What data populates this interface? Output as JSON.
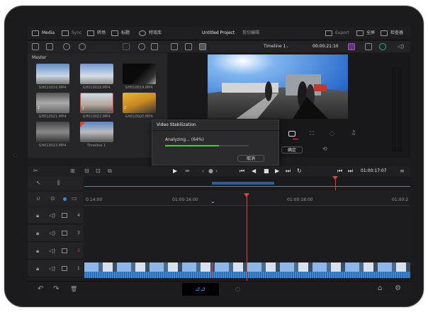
{
  "topbar": {
    "media": "Media",
    "sync": "Sync",
    "title_btn": "转场",
    "effects": "标题",
    "ext": "特效库",
    "project": "Untitled Project",
    "project_sub": "剪切编辑",
    "export": "Export",
    "fullscreen": "全屏",
    "inspector": "检查器"
  },
  "pool": {
    "heading": "Master",
    "clips": [
      "GH010016.MP4",
      "GH010018.MP4",
      "GH010019.MP4",
      "GH010021.MP4",
      "GH010022.MP4",
      "GH010020.MP4",
      "GH010023.MP4",
      "Timeline 1"
    ]
  },
  "viewer": {
    "timeline_name": "Timeline 1",
    "timecode": "00:00:21:10",
    "confirm": "确定"
  },
  "dialog": {
    "title": "Video Stabilization",
    "status": "Analyzing... (64%)",
    "progress": 0.64,
    "cancel": "取消"
  },
  "timeline": {
    "ctrl_timecode": "01:00:17:07",
    "ruler_start": "0:14:00",
    "ruler_mid": "01:00:16:00",
    "ruler_2": "01:00:18:00",
    "ruler_3": "01:00:2",
    "mini_label": "00:00:16:00",
    "tracks": [
      "4",
      "3",
      "2",
      "1"
    ],
    "active_track": "2"
  },
  "colors": {
    "accent_red": "#e0403a",
    "clip_blue": "#2c5aa0",
    "audio_blue": "#3c8bd8"
  }
}
